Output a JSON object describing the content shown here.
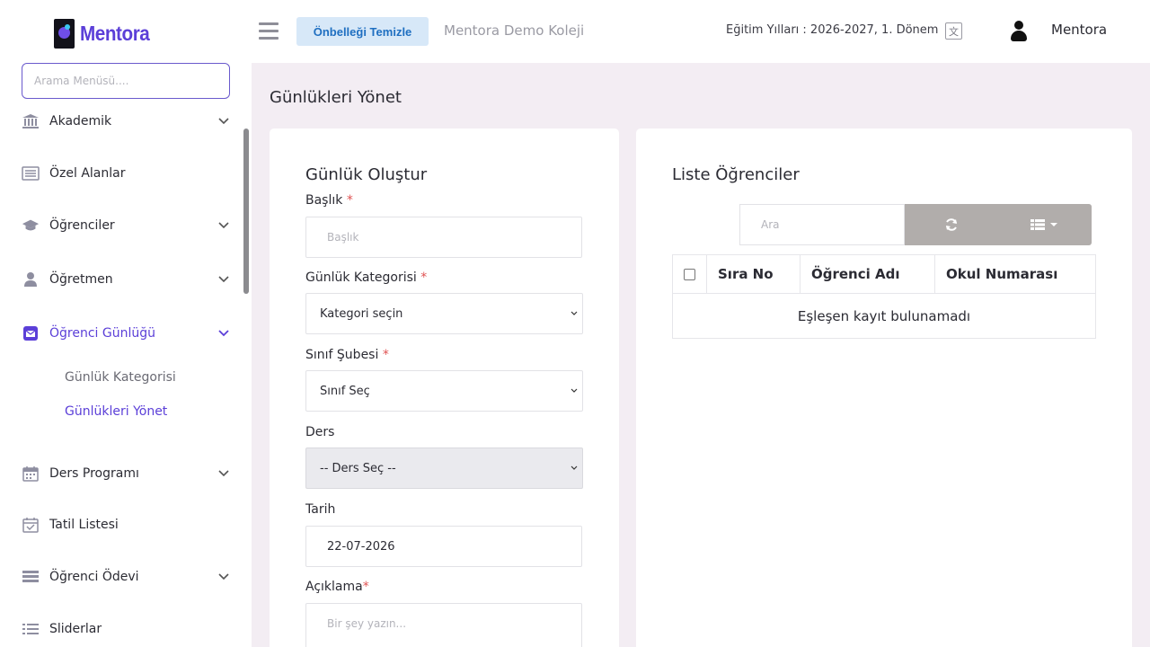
{
  "header": {
    "logo_text": "Mentora",
    "cache_button": "Önbelleği Temizle",
    "school_name": "Mentora Demo Koleji",
    "academic_years": "Eğitim Yılları : 2026-2027, 1. Dönem",
    "user_name": "Mentora"
  },
  "sidebar": {
    "search_placeholder": "Arama Menüsü....",
    "items": [
      {
        "label": "Akademik",
        "icon": "bank-icon"
      },
      {
        "label": "Özel Alanlar",
        "icon": "list-box-icon"
      },
      {
        "label": "Öğrenciler",
        "icon": "graduation-cap-icon"
      },
      {
        "label": "Öğretmen",
        "icon": "user-icon"
      },
      {
        "label": "Öğrenci Günlüğü",
        "icon": "envelope-icon"
      },
      {
        "label": "Ders Programı",
        "icon": "calendar-icon"
      },
      {
        "label": "Tatil Listesi",
        "icon": "calendar-check-icon"
      },
      {
        "label": "Öğrenci Ödevi",
        "icon": "stack-icon"
      },
      {
        "label": "Sliderlar",
        "icon": "list-icon"
      }
    ],
    "sub_items": [
      "Günlük Kategorisi",
      "Günlükleri Yönet"
    ],
    "accent_color": "#5b3fd8"
  },
  "page": {
    "title": "Günlükleri Yönet"
  },
  "form": {
    "title": "Günlük Oluştur",
    "title_label": "Başlık",
    "title_placeholder": "Başlık",
    "category_label": "Günlük Kategorisi",
    "category_value": "Kategori seçin",
    "class_label": "Sınıf Şubesi",
    "class_value": "Sınıf Seç",
    "subject_label": "Ders",
    "subject_value": "-- Ders Seç --",
    "date_label": "Tarih",
    "date_value": "22-07-2026",
    "desc_label": "Açıklama",
    "desc_placeholder": "Bir şey yazın...",
    "required_mark": "*"
  },
  "students": {
    "title": "Liste Öğrenciler",
    "search_placeholder": "Ara",
    "columns": [
      "Sıra No",
      "Öğrenci Adı",
      "Okul Numarası"
    ],
    "empty_message": "Eşleşen kayıt bulunamadı"
  }
}
